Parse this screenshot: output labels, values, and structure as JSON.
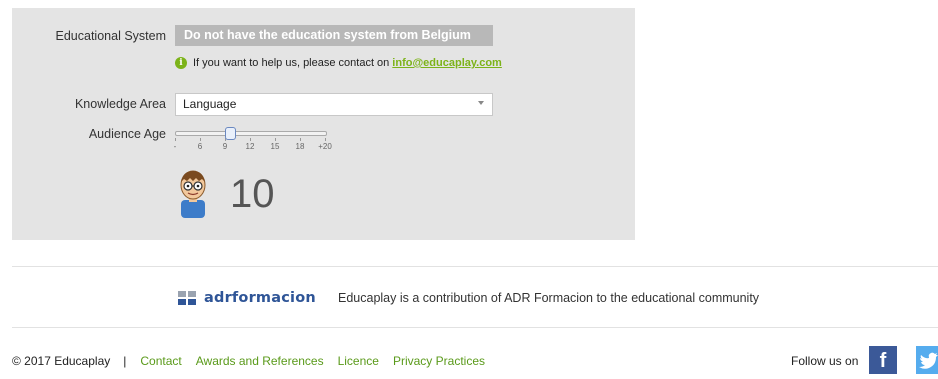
{
  "form": {
    "educational_system_label": "Educational System",
    "educational_system_value": "Do not have the education system from Belgium",
    "info_text": "If you want to help us, please contact on",
    "info_email": "info@educaplay.com",
    "knowledge_area_label": "Knowledge Area",
    "knowledge_area_value": "Language",
    "audience_age_label": "Audience Age",
    "age_ticks": [
      "-",
      "6",
      "9",
      "12",
      "15",
      "18",
      "+20"
    ],
    "age_slider_selected": "9",
    "age_value": "10"
  },
  "branding": {
    "logo_text": "adrformacion",
    "contribution_text": "Educaplay is a contribution of ADR Formacion to the educational community"
  },
  "footer": {
    "copyright": "© 2017 Educaplay",
    "separator": "|",
    "links": [
      "Contact",
      "Awards and References",
      "Licence",
      "Privacy Practices"
    ],
    "follow_label": "Follow us on"
  },
  "colors": {
    "panel_bg": "#e4e4e4",
    "link_green": "#5a9a1a",
    "info_green": "#7cb319",
    "facebook_blue": "#3b5998",
    "twitter_blue": "#55acee",
    "logo_blue": "#2f5597"
  },
  "icons": [
    "info-icon",
    "user-avatar-icon",
    "dropdown-arrow-icon",
    "facebook-icon",
    "twitter-icon"
  ]
}
